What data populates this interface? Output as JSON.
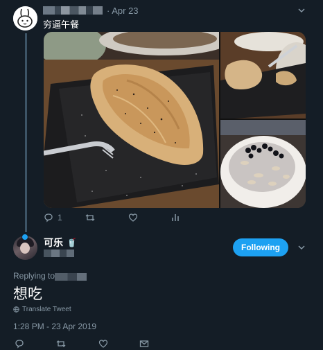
{
  "tweet1": {
    "date": "· Apr 23",
    "text": "穷逼午餐",
    "stats": {
      "replies": "1"
    }
  },
  "tweet2": {
    "display_name": "可乐",
    "name_emoji": "🥤",
    "follow_label": "Following",
    "replying_label": "Replying to",
    "text": "想吃",
    "translate_label": "Translate Tweet",
    "timestamp": "1:28 PM - 23 Apr 2019"
  },
  "colors": {
    "background": "#141d26",
    "secondary_text": "#8899a6",
    "accent": "#1da1f2",
    "thread_line": "#3d5466"
  },
  "icons": {
    "tweet1_actions": [
      "reply-icon",
      "retweet-icon",
      "like-icon",
      "analytics-icon"
    ],
    "tweet2_actions": [
      "reply-icon",
      "retweet-icon",
      "like-icon",
      "message-icon"
    ]
  }
}
